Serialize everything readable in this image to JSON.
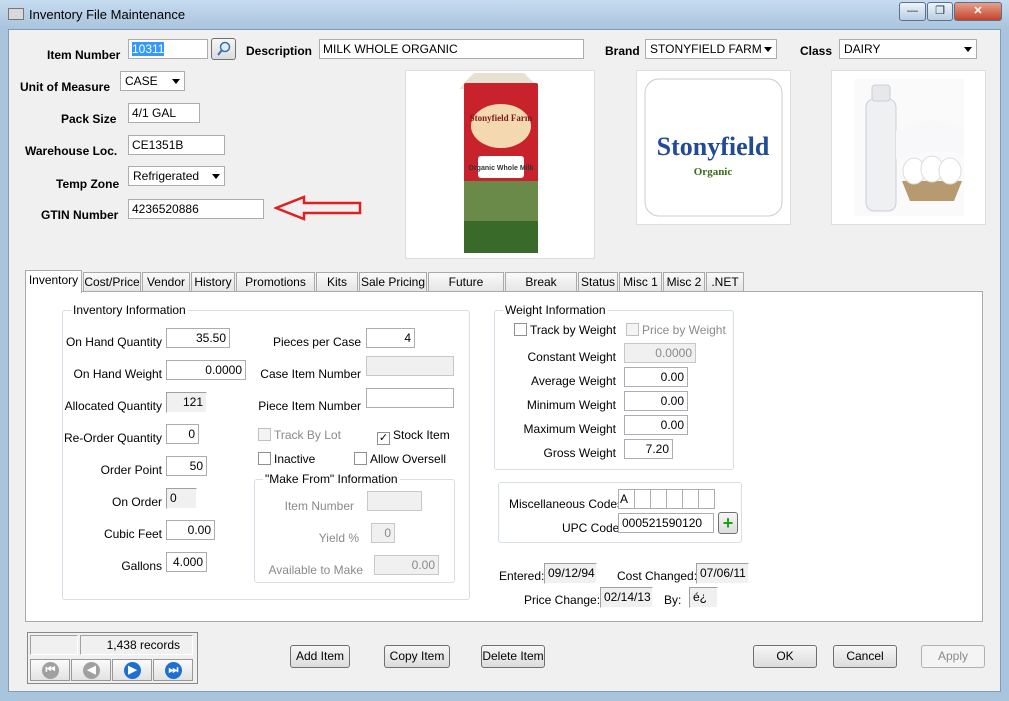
{
  "window": {
    "title": "Inventory File Maintenance",
    "min": "—",
    "max": "❐",
    "close": "✕"
  },
  "header": {
    "item_number_label": "Item Number",
    "item_number": "10311",
    "description_label": "Description",
    "description": "MILK WHOLE ORGANIC",
    "brand_label": "Brand",
    "brand": "STONYFIELD FARM",
    "class_label": "Class",
    "class": "DAIRY",
    "uom_label": "Unit of Measure",
    "uom": "CASE",
    "pack_size_label": "Pack Size",
    "pack_size": "4/1 GAL",
    "warehouse_label": "Warehouse Loc.",
    "warehouse": "CE1351B",
    "temp_zone_label": "Temp Zone",
    "temp_zone": "Refrigerated",
    "gtin_label": "GTIN Number",
    "gtin": "4236520886"
  },
  "images": {
    "carton_brand": "Stonyfield Farm",
    "carton_product": "Organic Whole Milk",
    "logo_text": "Stonyfield",
    "logo_sub": "Organic"
  },
  "tabs": [
    "Inventory",
    "Cost/Price",
    "Vendor",
    "History",
    "Promotions",
    "Kits",
    "Sale Pricing",
    "Future Pricing",
    "Break Pricing",
    "Status",
    "Misc 1",
    "Misc 2",
    ".NET"
  ],
  "inventory": {
    "title": "Inventory Information",
    "on_hand_qty_label": "On Hand Quantity",
    "on_hand_qty": "35.50",
    "on_hand_weight_label": "On Hand Weight",
    "on_hand_weight": "0.0000",
    "allocated_label": "Allocated Quantity",
    "allocated": "121",
    "reorder_label": "Re-Order Quantity",
    "reorder": "0",
    "order_point_label": "Order Point",
    "order_point": "50",
    "on_order_label": "On Order",
    "on_order": "0",
    "cubic_feet_label": "Cubic Feet",
    "cubic_feet": "0.00",
    "gallons_label": "Gallons",
    "gallons": "4.000",
    "pieces_label": "Pieces per Case",
    "pieces": "4",
    "case_item_label": "Case Item Number",
    "case_item": "",
    "piece_item_label": "Piece Item Number",
    "piece_item": "",
    "track_lot_label": "Track By Lot",
    "stock_item_label": "Stock Item",
    "inactive_label": "Inactive",
    "allow_oversell_label": "Allow Oversell",
    "make_from_title": "\"Make From\" Information",
    "mf_item_label": "Item Number",
    "mf_item": "",
    "mf_yield_label": "Yield %",
    "mf_yield": "0",
    "mf_avail_label": "Available to Make",
    "mf_avail": "0.00"
  },
  "weight": {
    "title": "Weight Information",
    "track_label": "Track by Weight",
    "price_label": "Price by Weight",
    "constant_label": "Constant Weight",
    "constant": "0.0000",
    "average_label": "Average Weight",
    "average": "0.00",
    "minimum_label": "Minimum Weight",
    "minimum": "0.00",
    "maximum_label": "Maximum Weight",
    "maximum": "0.00",
    "gross_label": "Gross Weight",
    "gross": "7.20"
  },
  "misc": {
    "codes_label": "Miscellaneous Codes",
    "codes": [
      "A",
      "",
      "",
      "",
      "",
      ""
    ],
    "upc_label": "UPC Code",
    "upc": "000521590120",
    "add": "+"
  },
  "dates": {
    "entered_label": "Entered:",
    "entered": "09/12/94",
    "cost_changed_label": "Cost Changed:",
    "cost_changed": "07/06/11",
    "price_change_label": "Price Change:",
    "price_change": "02/14/13",
    "by_label": "By:",
    "by": "é¿"
  },
  "navigator": {
    "records": "1,438 records"
  },
  "buttons": {
    "add": "Add Item",
    "copy": "Copy Item",
    "delete": "Delete Item",
    "ok": "OK",
    "cancel": "Cancel",
    "apply": "Apply"
  },
  "colors": {
    "arrow": "#e02020",
    "nav_disabled": "#a0a0a0",
    "nav_enabled": "#1f6fd0",
    "plus": "#1aa11a"
  }
}
